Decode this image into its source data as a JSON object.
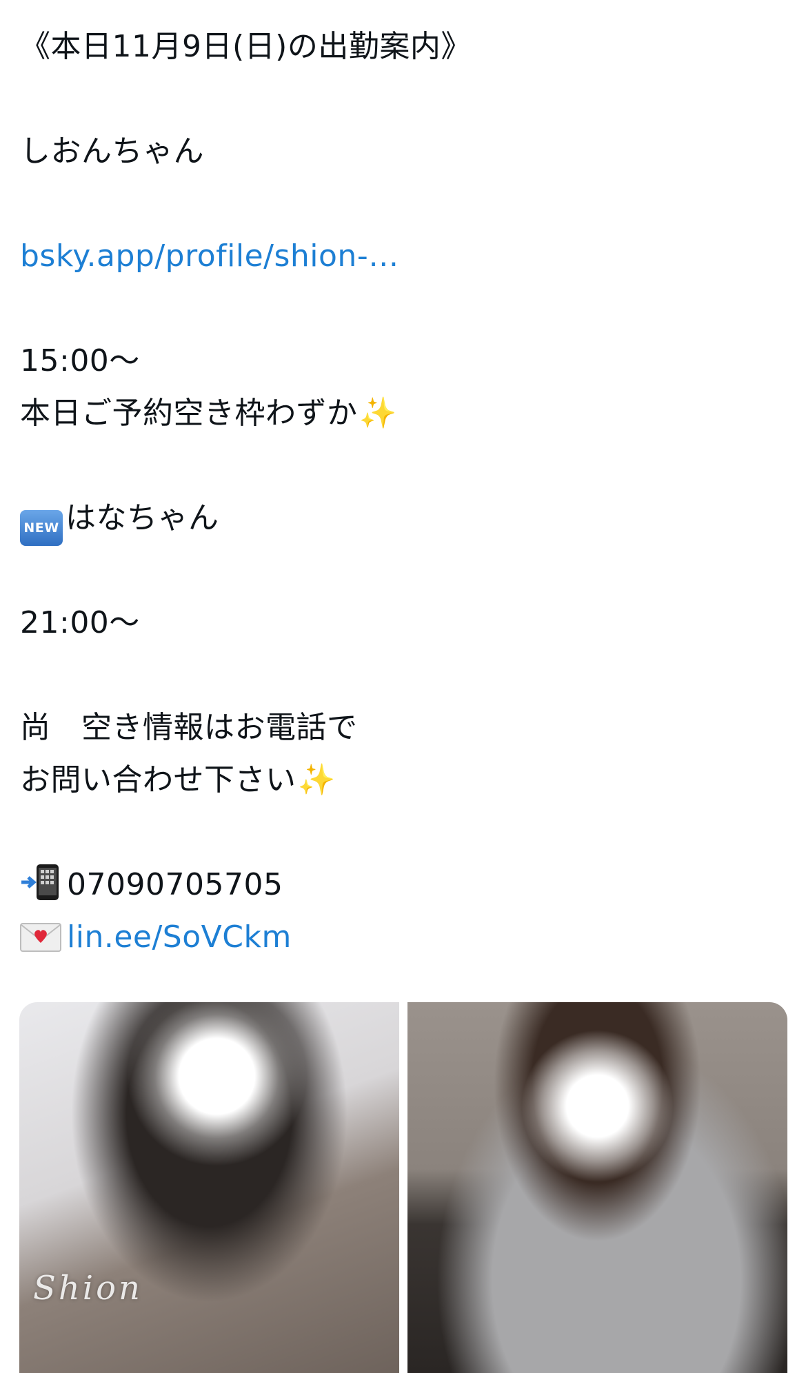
{
  "post": {
    "heading": "《本日11月9日(日)の出勤案内》",
    "girl1_name": "しおんちゃん",
    "girl1_link": "bsky.app/profile/shion-…",
    "girl1_time": "15:00〜",
    "girl1_note": "本日ご予約空き枠わずか",
    "girl2_badge": "NEW",
    "girl2_name": "はなちゃん",
    "girl2_time": "21:00〜",
    "notice_line1": "尚　空き情報はお電話で",
    "notice_line2": "お問い合わせ下さい",
    "phone_number": "07090705705",
    "line_link": "lin.ee/SoVCkm",
    "sparkle_icon": "sparkles-emoji",
    "link_color": "#1d7fd4"
  },
  "media": {
    "left_watermark": "Shion"
  }
}
